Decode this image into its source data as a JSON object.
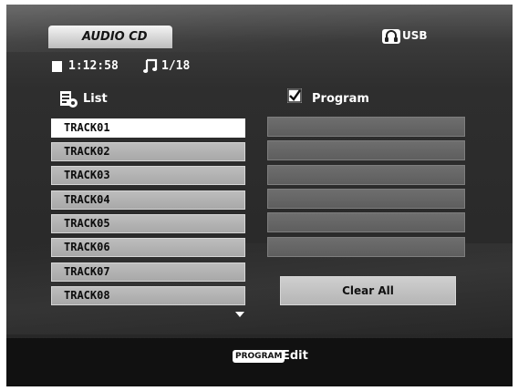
{
  "header": {
    "tab_label": "AUDIO CD",
    "source_label": "USB"
  },
  "status": {
    "time": "1:12:58",
    "track_counter": "1/18"
  },
  "list_panel": {
    "label": "List",
    "tracks": [
      "TRACK01",
      "TRACK02",
      "TRACK03",
      "TRACK04",
      "TRACK05",
      "TRACK06",
      "TRACK07",
      "TRACK08"
    ]
  },
  "program_panel": {
    "label": "Program",
    "checked": true,
    "slots": [
      "",
      "",
      "",
      "",
      "",
      ""
    ],
    "clear_button": "Clear All"
  },
  "footer": {
    "key_label": "PROGRAM",
    "action_label": "Edit"
  },
  "icons": {
    "stop": "stop-icon",
    "note": "music-note-icon",
    "list": "list-icon",
    "check": "checkbox-icon",
    "usb": "headphone-usb-icon",
    "scroll": "scroll-down-icon"
  }
}
